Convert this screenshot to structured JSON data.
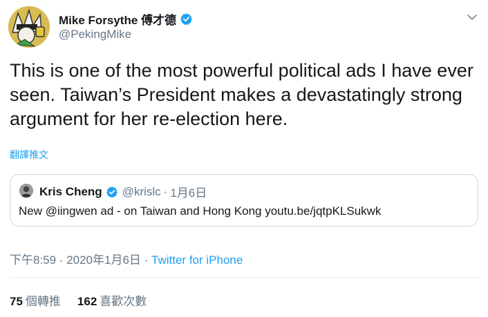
{
  "author": {
    "display_name": "Mike Forsythe 傅才德",
    "handle": "@PekingMike",
    "verified": true,
    "avatar_icon": "cartoon-avatar-icon"
  },
  "tweet": {
    "text": "This is one of the most powerful political ads I have ever seen. Taiwan’s President makes a devastatingly strong argument for her re-election here.",
    "translate_label": "翻譯推文"
  },
  "quote": {
    "display_name": "Kris Cheng",
    "handle": "@krislc",
    "separator": "·",
    "date": "1月6日",
    "text": "New @iingwen ad - on Taiwan and Hong Kong youtu.be/jqtpKLSukwk",
    "verified": true
  },
  "meta": {
    "timestamp": "下午8:59 · 2020年1月6日 · ",
    "source": "Twitter for iPhone"
  },
  "stats": {
    "retweets_count": "75",
    "retweets_label": "個轉推",
    "likes_count": "162",
    "likes_label": "喜歡次數"
  },
  "colors": {
    "link": "#1da1f2",
    "muted": "#657786",
    "text": "#14171a",
    "border": "#ccd6dd"
  }
}
